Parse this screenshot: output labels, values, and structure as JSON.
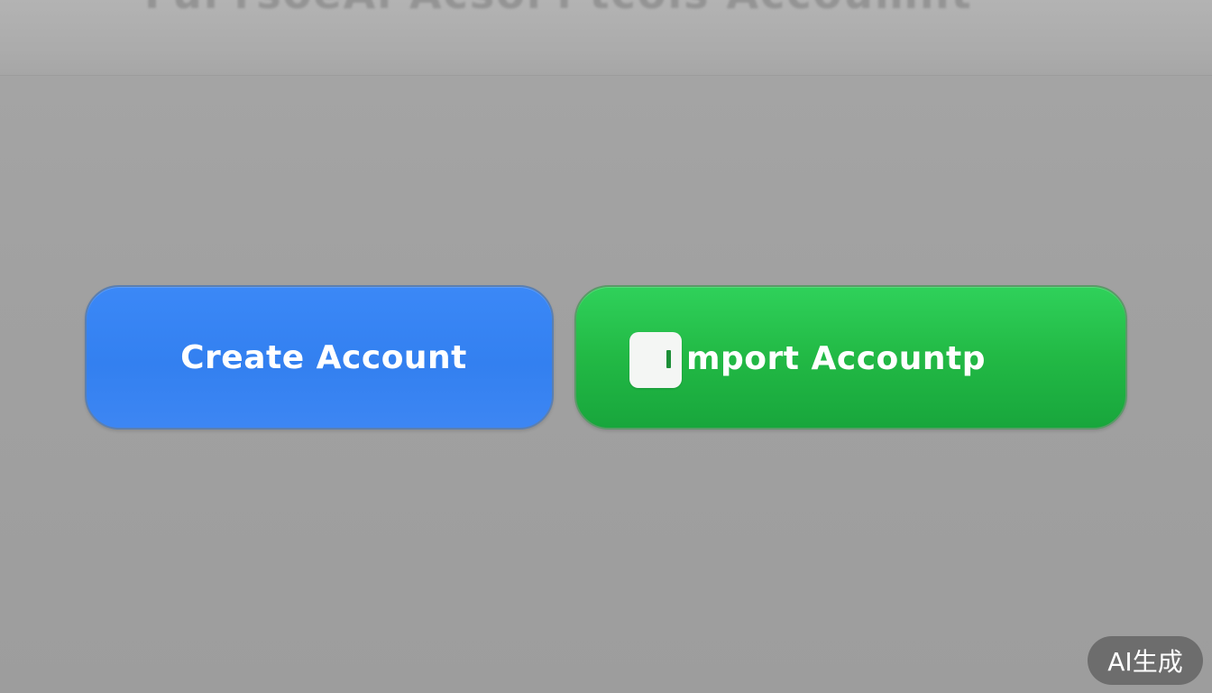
{
  "header": {
    "text": "Ful'rsoeAl Acsoi'l tcols Accoumnt"
  },
  "buttons": {
    "create_label": "Create Account",
    "import_label": "mport Accountp",
    "import_icon": "import-square-icon"
  },
  "badge": {
    "label": "AI生成"
  },
  "colors": {
    "background": "#a2a2a2",
    "create_button": "#3884f4",
    "import_button": "#22b945",
    "badge": "#5a5a5a"
  }
}
